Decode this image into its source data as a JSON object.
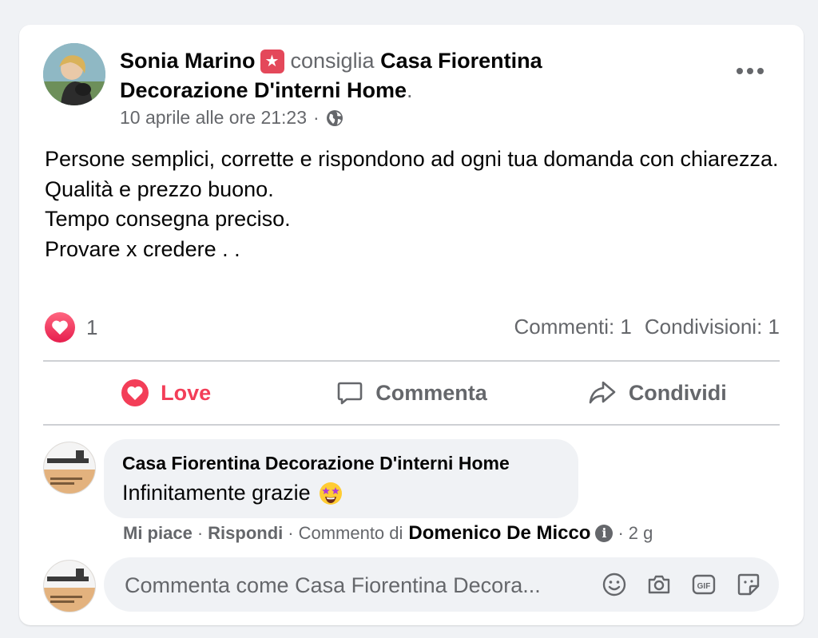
{
  "post": {
    "author": "Sonia Marino",
    "verb": "consiglia",
    "page": "Casa Fiorentina Decorazione D'interni Home",
    "timestamp": "10 aprile alle ore 21:23",
    "separator": "·",
    "lines": [
      "Persone semplici, corrette e rispondono ad ogni tua domanda con chiarezza.",
      "Qualità e prezzo buono.",
      "Tempo consegna preciso.",
      "Provare x credere . ."
    ]
  },
  "reactions": {
    "count": "1"
  },
  "stats": {
    "comments": "Commenti: 1",
    "shares": "Condivisioni: 1"
  },
  "actions": {
    "love": "Love",
    "comment": "Commenta",
    "share": "Condividi"
  },
  "comment": {
    "author": "Casa Fiorentina Decorazione D'interni Home",
    "text": "Infinitamente grazie",
    "like": "Mi piace",
    "reply": "Rispondi",
    "by_label": "Commento di",
    "by_name": "Domenico De Micco",
    "age": "2 g"
  },
  "compose": {
    "placeholder": "Commenta come Casa Fiorentina Decora..."
  },
  "colors": {
    "love": "#f33e58",
    "muted": "#65676b",
    "background": "#f0f2f5"
  },
  "icons": [
    "recommend-star-icon",
    "globe-icon",
    "more-icon",
    "heart-icon",
    "comment-icon",
    "share-icon",
    "info-icon",
    "emoji-icon",
    "camera-icon",
    "gif-icon",
    "sticker-icon"
  ]
}
